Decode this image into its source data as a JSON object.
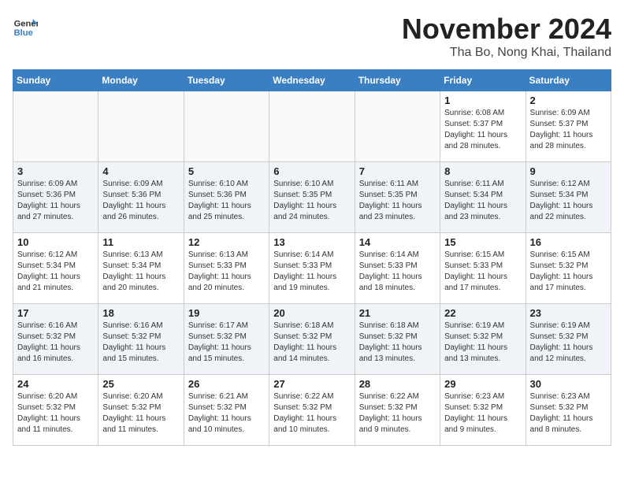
{
  "header": {
    "logo_general": "General",
    "logo_blue": "Blue",
    "month_title": "November 2024",
    "location": "Tha Bo, Nong Khai, Thailand"
  },
  "weekdays": [
    "Sunday",
    "Monday",
    "Tuesday",
    "Wednesday",
    "Thursday",
    "Friday",
    "Saturday"
  ],
  "weeks": [
    [
      {
        "day": "",
        "info": ""
      },
      {
        "day": "",
        "info": ""
      },
      {
        "day": "",
        "info": ""
      },
      {
        "day": "",
        "info": ""
      },
      {
        "day": "",
        "info": ""
      },
      {
        "day": "1",
        "info": "Sunrise: 6:08 AM\nSunset: 5:37 PM\nDaylight: 11 hours and 28 minutes."
      },
      {
        "day": "2",
        "info": "Sunrise: 6:09 AM\nSunset: 5:37 PM\nDaylight: 11 hours and 28 minutes."
      }
    ],
    [
      {
        "day": "3",
        "info": "Sunrise: 6:09 AM\nSunset: 5:36 PM\nDaylight: 11 hours and 27 minutes."
      },
      {
        "day": "4",
        "info": "Sunrise: 6:09 AM\nSunset: 5:36 PM\nDaylight: 11 hours and 26 minutes."
      },
      {
        "day": "5",
        "info": "Sunrise: 6:10 AM\nSunset: 5:36 PM\nDaylight: 11 hours and 25 minutes."
      },
      {
        "day": "6",
        "info": "Sunrise: 6:10 AM\nSunset: 5:35 PM\nDaylight: 11 hours and 24 minutes."
      },
      {
        "day": "7",
        "info": "Sunrise: 6:11 AM\nSunset: 5:35 PM\nDaylight: 11 hours and 23 minutes."
      },
      {
        "day": "8",
        "info": "Sunrise: 6:11 AM\nSunset: 5:34 PM\nDaylight: 11 hours and 23 minutes."
      },
      {
        "day": "9",
        "info": "Sunrise: 6:12 AM\nSunset: 5:34 PM\nDaylight: 11 hours and 22 minutes."
      }
    ],
    [
      {
        "day": "10",
        "info": "Sunrise: 6:12 AM\nSunset: 5:34 PM\nDaylight: 11 hours and 21 minutes."
      },
      {
        "day": "11",
        "info": "Sunrise: 6:13 AM\nSunset: 5:34 PM\nDaylight: 11 hours and 20 minutes."
      },
      {
        "day": "12",
        "info": "Sunrise: 6:13 AM\nSunset: 5:33 PM\nDaylight: 11 hours and 20 minutes."
      },
      {
        "day": "13",
        "info": "Sunrise: 6:14 AM\nSunset: 5:33 PM\nDaylight: 11 hours and 19 minutes."
      },
      {
        "day": "14",
        "info": "Sunrise: 6:14 AM\nSunset: 5:33 PM\nDaylight: 11 hours and 18 minutes."
      },
      {
        "day": "15",
        "info": "Sunrise: 6:15 AM\nSunset: 5:33 PM\nDaylight: 11 hours and 17 minutes."
      },
      {
        "day": "16",
        "info": "Sunrise: 6:15 AM\nSunset: 5:32 PM\nDaylight: 11 hours and 17 minutes."
      }
    ],
    [
      {
        "day": "17",
        "info": "Sunrise: 6:16 AM\nSunset: 5:32 PM\nDaylight: 11 hours and 16 minutes."
      },
      {
        "day": "18",
        "info": "Sunrise: 6:16 AM\nSunset: 5:32 PM\nDaylight: 11 hours and 15 minutes."
      },
      {
        "day": "19",
        "info": "Sunrise: 6:17 AM\nSunset: 5:32 PM\nDaylight: 11 hours and 15 minutes."
      },
      {
        "day": "20",
        "info": "Sunrise: 6:18 AM\nSunset: 5:32 PM\nDaylight: 11 hours and 14 minutes."
      },
      {
        "day": "21",
        "info": "Sunrise: 6:18 AM\nSunset: 5:32 PM\nDaylight: 11 hours and 13 minutes."
      },
      {
        "day": "22",
        "info": "Sunrise: 6:19 AM\nSunset: 5:32 PM\nDaylight: 11 hours and 13 minutes."
      },
      {
        "day": "23",
        "info": "Sunrise: 6:19 AM\nSunset: 5:32 PM\nDaylight: 11 hours and 12 minutes."
      }
    ],
    [
      {
        "day": "24",
        "info": "Sunrise: 6:20 AM\nSunset: 5:32 PM\nDaylight: 11 hours and 11 minutes."
      },
      {
        "day": "25",
        "info": "Sunrise: 6:20 AM\nSunset: 5:32 PM\nDaylight: 11 hours and 11 minutes."
      },
      {
        "day": "26",
        "info": "Sunrise: 6:21 AM\nSunset: 5:32 PM\nDaylight: 11 hours and 10 minutes."
      },
      {
        "day": "27",
        "info": "Sunrise: 6:22 AM\nSunset: 5:32 PM\nDaylight: 11 hours and 10 minutes."
      },
      {
        "day": "28",
        "info": "Sunrise: 6:22 AM\nSunset: 5:32 PM\nDaylight: 11 hours and 9 minutes."
      },
      {
        "day": "29",
        "info": "Sunrise: 6:23 AM\nSunset: 5:32 PM\nDaylight: 11 hours and 9 minutes."
      },
      {
        "day": "30",
        "info": "Sunrise: 6:23 AM\nSunset: 5:32 PM\nDaylight: 11 hours and 8 minutes."
      }
    ]
  ]
}
